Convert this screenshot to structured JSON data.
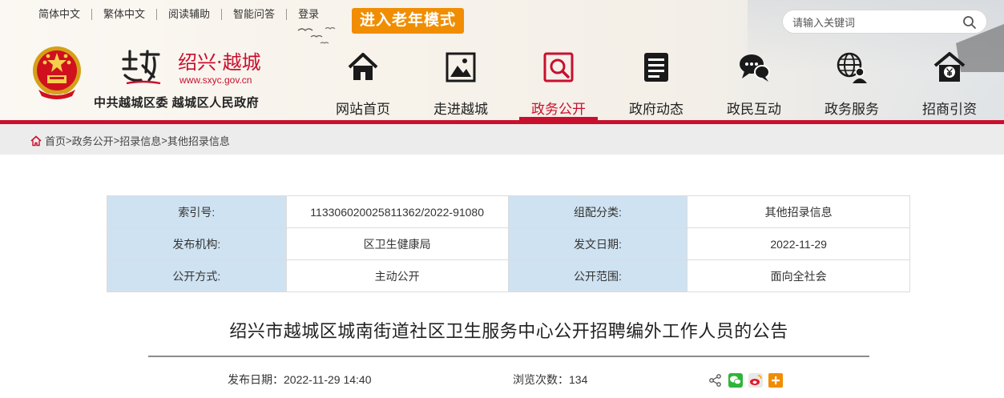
{
  "topnav": {
    "items": [
      "简体中文",
      "繁体中文",
      "阅读辅助",
      "智能问答",
      "登录"
    ],
    "elder_mode": "进入老年模式"
  },
  "search": {
    "placeholder": "请输入关键词"
  },
  "logo": {
    "name_cn": "绍兴·越城",
    "url": "www.sxyc.gov.cn",
    "org": "中共越城区委  越城区人民政府"
  },
  "mainnav": {
    "items": [
      {
        "label": "网站首页",
        "icon": "home-icon"
      },
      {
        "label": "走进越城",
        "icon": "picture-icon"
      },
      {
        "label": "政务公开",
        "icon": "search-document-icon",
        "active": true
      },
      {
        "label": "政府动态",
        "icon": "news-icon"
      },
      {
        "label": "政民互动",
        "icon": "chat-icon"
      },
      {
        "label": "政务服务",
        "icon": "globe-user-icon"
      },
      {
        "label": "招商引资",
        "icon": "yuan-house-icon"
      }
    ]
  },
  "breadcrumb": [
    "首页",
    "政务公开",
    "招录信息",
    "其他招录信息"
  ],
  "info": {
    "rows": [
      {
        "k1": "索引号:",
        "v1": "113306020025811362/2022-91080",
        "k2": "组配分类:",
        "v2": "其他招录信息"
      },
      {
        "k1": "发布机构:",
        "v1": "区卫生健康局",
        "k2": "发文日期:",
        "v2": "2022-11-29"
      },
      {
        "k1": "公开方式:",
        "v1": "主动公开",
        "k2": "公开范围:",
        "v2": "面向全社会"
      }
    ]
  },
  "article": {
    "title": "绍兴市越城区城南街道社区卫生服务中心公开招聘编外工作人员的公告",
    "date_label": "发布日期：",
    "date": "2022-11-29 14:40",
    "views_label": "浏览次数：",
    "views": "134"
  },
  "colors": {
    "brand_red": "#c8102e",
    "elder_orange": "#f18d00",
    "key_cell_blue": "#cfe2f1"
  }
}
